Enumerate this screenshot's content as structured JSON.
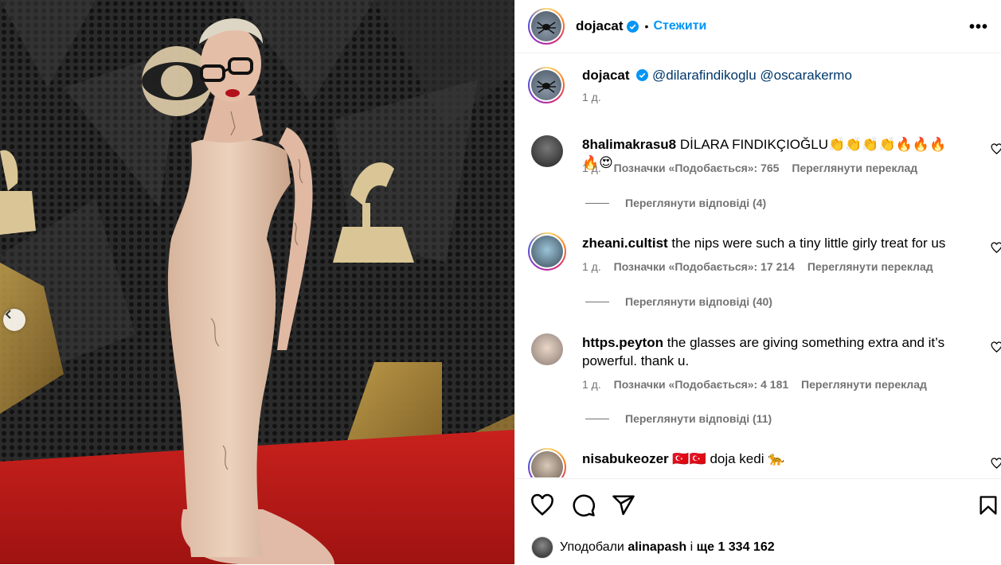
{
  "header": {
    "username": "dojacat",
    "follow_label": "Стежити",
    "more_label": "•••"
  },
  "caption": {
    "username": "dojacat",
    "mention1": "@dilarafindikoglu",
    "mention2": "@oscarakermo",
    "time": "1 д."
  },
  "comments": [
    {
      "user": "8halimakrasu8",
      "text": "DİLARA FINDIKÇIOĞLU👏👏👏👏🔥🔥🔥🔥😍",
      "time": "1 д.",
      "likes": "Позначки «Подобається»: 765",
      "translate": "Переглянути переклад",
      "replies": "Переглянути відповіді (4)"
    },
    {
      "user": "zheani.cultist",
      "text": "the nips were such a tiny little girly treat for us",
      "time": "1 д.",
      "likes": "Позначки «Подобається»: 17 214",
      "translate": "Переглянути переклад",
      "replies": "Переглянути відповіді (40)"
    },
    {
      "user": "https.peyton",
      "text": "the glasses are giving something extra and it’s powerful. thank u.",
      "time": "1 д.",
      "likes": "Позначки «Подобається»: 4 181",
      "translate": "Переглянути переклад",
      "replies": "Переглянути відповіді (11)"
    },
    {
      "user": "nisabukeozer",
      "text": "🇹🇷🇹🇷 doja kedi 🐆"
    }
  ],
  "likes_bar": {
    "prefix": "Уподобали",
    "user": "alinapash",
    "middle": "і",
    "rest": "ще 1 334 162"
  },
  "colors": {
    "accent": "#0095f6",
    "verified": "#0095f6",
    "secondary_text": "#737373"
  },
  "icons": [
    "chevron-left-icon",
    "verified-badge-icon",
    "more-icon",
    "heart-icon",
    "comment-icon",
    "share-icon",
    "bookmark-icon"
  ]
}
